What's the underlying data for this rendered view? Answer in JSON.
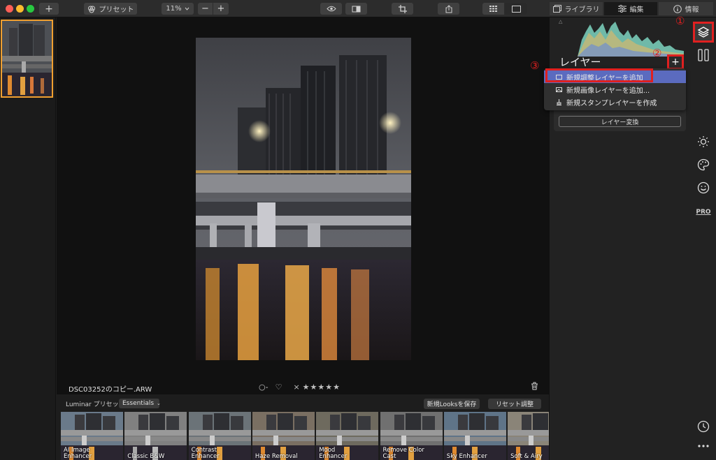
{
  "toolbar": {
    "add_label": "+",
    "presets_label": "プリセット",
    "zoom_label": "11%",
    "zoom_out_label": "−",
    "zoom_in_label": "+",
    "tab_library": "ライブラリ",
    "tab_edit": "編集",
    "tab_info": "情報"
  },
  "image": {
    "filename": "DSC03252のコピー.ARW",
    "rating_stars": "★★★★★",
    "flag_label": "○-",
    "reject_label": "×"
  },
  "presets": {
    "bar_label": "Luminar プリセット",
    "category": "Essentials",
    "save_looks_label": "新規Looksを保存",
    "reset_label": "リセット調整",
    "items": [
      {
        "label": "AI Image\nEnhancer"
      },
      {
        "label": "Classic B&W"
      },
      {
        "label": "Contrast\nEnhancer"
      },
      {
        "label": "Haze Removal"
      },
      {
        "label": "Mood\nEnhancer"
      },
      {
        "label": "Remove Color\nCast"
      },
      {
        "label": "Sky Enhancer"
      },
      {
        "label": "Soft & Airy"
      }
    ]
  },
  "layers_panel": {
    "title": "レイヤー",
    "add_label": "+",
    "convert_label": "レイヤー変換",
    "menu": [
      {
        "label": "新規調整レイヤーを追加"
      },
      {
        "label": "新規画像レイヤーを追加..."
      },
      {
        "label": "新規スタンプレイヤーを作成"
      }
    ]
  },
  "annotations": {
    "one": "①",
    "two": "②",
    "three": "③"
  },
  "side_icons": {
    "pro_label": "PRO"
  },
  "colors": {
    "annotation_red": "#e02020",
    "menu_selected": "#5b6bbf",
    "thumb_selected": "#f0a030"
  }
}
